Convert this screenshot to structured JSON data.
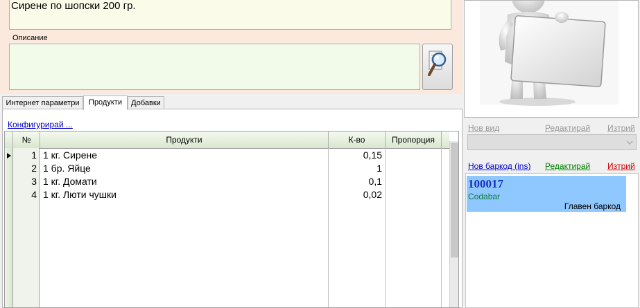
{
  "product": {
    "name": "Сирене по шопски 200 гр.",
    "description_label": "Описание",
    "description": ""
  },
  "tabs": [
    {
      "label": "Интернет параметри",
      "active": false
    },
    {
      "label": "Продукти",
      "active": true
    },
    {
      "label": "Добавки",
      "active": false
    }
  ],
  "products_tab": {
    "configure_link": "Конфигурирай ...",
    "columns": [
      "№",
      "Продукти",
      "К-во",
      "Пропорция"
    ],
    "rows": [
      {
        "num": "1",
        "product": "1 кг. Сирене",
        "qty": "0,15",
        "proportion": ""
      },
      {
        "num": "2",
        "product": "1 бр. Яйце",
        "qty": "1",
        "proportion": ""
      },
      {
        "num": "3",
        "product": "1 кг. Домати",
        "qty": "0,1",
        "proportion": ""
      },
      {
        "num": "4",
        "product": "1 кг. Люти чушки",
        "qty": "0,02",
        "proportion": ""
      }
    ]
  },
  "type_section": {
    "new": "Нов вид",
    "edit": "Редактирай",
    "delete": "Изтрий",
    "selected": ""
  },
  "barcode_section": {
    "new": "Нов баркод (ins)",
    "edit": "Редактирай",
    "delete": "Изтрий",
    "items": [
      {
        "code": "100017",
        "type": "Codabar",
        "label": "Главен баркод"
      }
    ]
  },
  "colors": {
    "top_panel": "#fbe9dd",
    "barcode_selected": "#8ec8ff",
    "link_blue": "#0000cc",
    "link_green": "#008000",
    "link_red": "#cc0000",
    "link_disabled": "#9a9a9a"
  }
}
